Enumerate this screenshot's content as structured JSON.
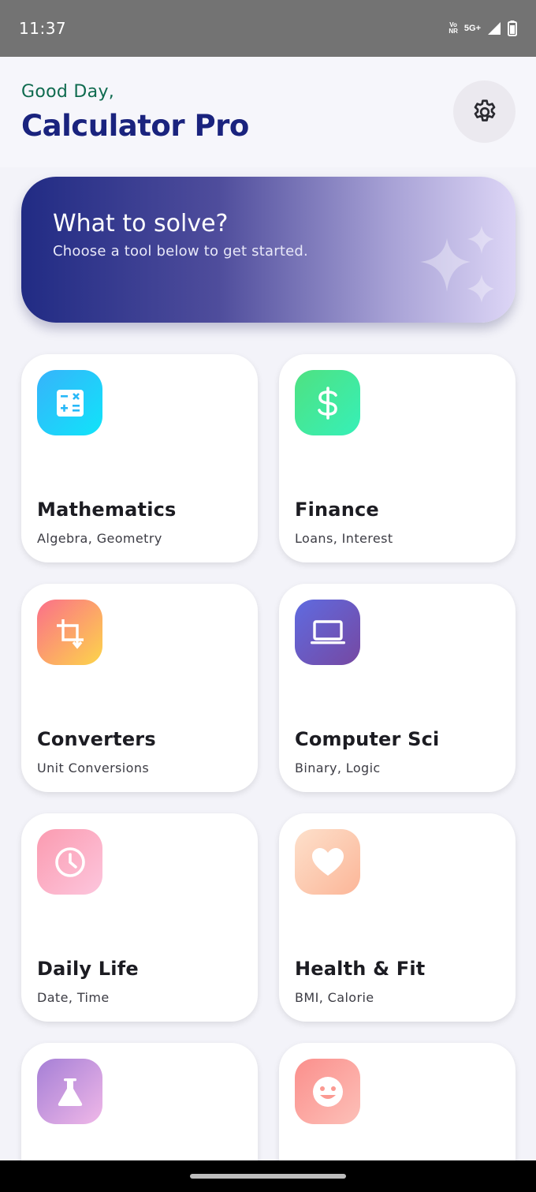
{
  "status_bar": {
    "time": "11:37",
    "network_top": "Vo",
    "network_bottom": "NR",
    "signal_type": "5G+",
    "icons": [
      "volte-icon",
      "signal-icon",
      "battery-icon"
    ]
  },
  "header": {
    "greeting": "Good Day,",
    "title": "Calculator Pro",
    "settings_icon": "gear-icon"
  },
  "hero": {
    "title": "What to solve?",
    "subtitle": "Choose a tool below to get started.",
    "decoration_icon": "sparkle-icon",
    "gradient": [
      "#212b84",
      "#ddd6f6"
    ]
  },
  "categories": [
    {
      "title": "Mathematics",
      "subtitle": "Algebra, Geometry",
      "icon": "calculator-icon",
      "colors": [
        "#37b3fb",
        "#10e4f9"
      ]
    },
    {
      "title": "Finance",
      "subtitle": "Loans, Interest",
      "icon": "dollar-icon",
      "colors": [
        "#4fe181",
        "#36f0b8"
      ]
    },
    {
      "title": "Converters",
      "subtitle": "Unit Conversions",
      "icon": "crop-icon",
      "colors": [
        "#fb6f8a",
        "#fcd54a"
      ]
    },
    {
      "title": "Computer Sci",
      "subtitle": "Binary, Logic",
      "icon": "laptop-icon",
      "colors": [
        "#5f6be0",
        "#7648a2"
      ]
    },
    {
      "title": "Daily Life",
      "subtitle": "Date, Time",
      "icon": "clock-icon",
      "colors": [
        "#fb9bb0",
        "#fcc6dd"
      ]
    },
    {
      "title": "Health & Fit",
      "subtitle": "BMI, Calorie",
      "icon": "heart-icon",
      "colors": [
        "#fde0cb",
        "#fcb698"
      ]
    },
    {
      "title": "",
      "subtitle": "",
      "icon": "flask-icon",
      "colors": [
        "#a57fd6",
        "#f0b8e8"
      ]
    },
    {
      "title": "",
      "subtitle": "",
      "icon": "smiley-icon",
      "colors": [
        "#fb8f8c",
        "#fcc0b8"
      ]
    }
  ]
}
